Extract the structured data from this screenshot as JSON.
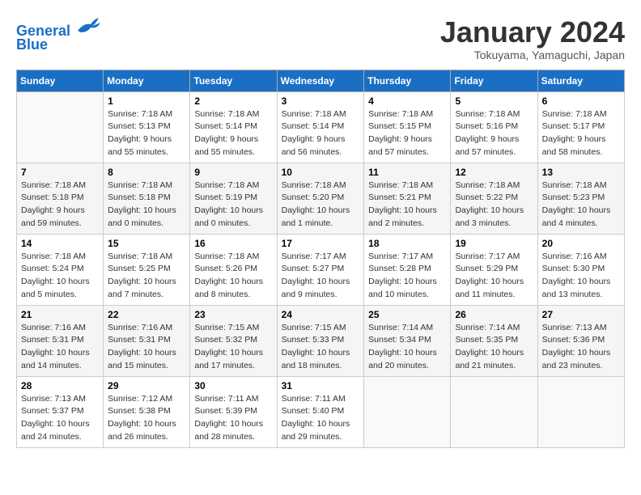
{
  "header": {
    "logo_line1": "General",
    "logo_line2": "Blue",
    "title": "January 2024",
    "location": "Tokuyama, Yamaguchi, Japan"
  },
  "days_of_week": [
    "Sunday",
    "Monday",
    "Tuesday",
    "Wednesday",
    "Thursday",
    "Friday",
    "Saturday"
  ],
  "weeks": [
    [
      {
        "day": "",
        "sunrise": "",
        "sunset": "",
        "daylight": ""
      },
      {
        "day": "1",
        "sunrise": "Sunrise: 7:18 AM",
        "sunset": "Sunset: 5:13 PM",
        "daylight": "Daylight: 9 hours and 55 minutes."
      },
      {
        "day": "2",
        "sunrise": "Sunrise: 7:18 AM",
        "sunset": "Sunset: 5:14 PM",
        "daylight": "Daylight: 9 hours and 55 minutes."
      },
      {
        "day": "3",
        "sunrise": "Sunrise: 7:18 AM",
        "sunset": "Sunset: 5:14 PM",
        "daylight": "Daylight: 9 hours and 56 minutes."
      },
      {
        "day": "4",
        "sunrise": "Sunrise: 7:18 AM",
        "sunset": "Sunset: 5:15 PM",
        "daylight": "Daylight: 9 hours and 57 minutes."
      },
      {
        "day": "5",
        "sunrise": "Sunrise: 7:18 AM",
        "sunset": "Sunset: 5:16 PM",
        "daylight": "Daylight: 9 hours and 57 minutes."
      },
      {
        "day": "6",
        "sunrise": "Sunrise: 7:18 AM",
        "sunset": "Sunset: 5:17 PM",
        "daylight": "Daylight: 9 hours and 58 minutes."
      }
    ],
    [
      {
        "day": "7",
        "sunrise": "Sunrise: 7:18 AM",
        "sunset": "Sunset: 5:18 PM",
        "daylight": "Daylight: 9 hours and 59 minutes."
      },
      {
        "day": "8",
        "sunrise": "Sunrise: 7:18 AM",
        "sunset": "Sunset: 5:18 PM",
        "daylight": "Daylight: 10 hours and 0 minutes."
      },
      {
        "day": "9",
        "sunrise": "Sunrise: 7:18 AM",
        "sunset": "Sunset: 5:19 PM",
        "daylight": "Daylight: 10 hours and 0 minutes."
      },
      {
        "day": "10",
        "sunrise": "Sunrise: 7:18 AM",
        "sunset": "Sunset: 5:20 PM",
        "daylight": "Daylight: 10 hours and 1 minute."
      },
      {
        "day": "11",
        "sunrise": "Sunrise: 7:18 AM",
        "sunset": "Sunset: 5:21 PM",
        "daylight": "Daylight: 10 hours and 2 minutes."
      },
      {
        "day": "12",
        "sunrise": "Sunrise: 7:18 AM",
        "sunset": "Sunset: 5:22 PM",
        "daylight": "Daylight: 10 hours and 3 minutes."
      },
      {
        "day": "13",
        "sunrise": "Sunrise: 7:18 AM",
        "sunset": "Sunset: 5:23 PM",
        "daylight": "Daylight: 10 hours and 4 minutes."
      }
    ],
    [
      {
        "day": "14",
        "sunrise": "Sunrise: 7:18 AM",
        "sunset": "Sunset: 5:24 PM",
        "daylight": "Daylight: 10 hours and 5 minutes."
      },
      {
        "day": "15",
        "sunrise": "Sunrise: 7:18 AM",
        "sunset": "Sunset: 5:25 PM",
        "daylight": "Daylight: 10 hours and 7 minutes."
      },
      {
        "day": "16",
        "sunrise": "Sunrise: 7:18 AM",
        "sunset": "Sunset: 5:26 PM",
        "daylight": "Daylight: 10 hours and 8 minutes."
      },
      {
        "day": "17",
        "sunrise": "Sunrise: 7:17 AM",
        "sunset": "Sunset: 5:27 PM",
        "daylight": "Daylight: 10 hours and 9 minutes."
      },
      {
        "day": "18",
        "sunrise": "Sunrise: 7:17 AM",
        "sunset": "Sunset: 5:28 PM",
        "daylight": "Daylight: 10 hours and 10 minutes."
      },
      {
        "day": "19",
        "sunrise": "Sunrise: 7:17 AM",
        "sunset": "Sunset: 5:29 PM",
        "daylight": "Daylight: 10 hours and 11 minutes."
      },
      {
        "day": "20",
        "sunrise": "Sunrise: 7:16 AM",
        "sunset": "Sunset: 5:30 PM",
        "daylight": "Daylight: 10 hours and 13 minutes."
      }
    ],
    [
      {
        "day": "21",
        "sunrise": "Sunrise: 7:16 AM",
        "sunset": "Sunset: 5:31 PM",
        "daylight": "Daylight: 10 hours and 14 minutes."
      },
      {
        "day": "22",
        "sunrise": "Sunrise: 7:16 AM",
        "sunset": "Sunset: 5:31 PM",
        "daylight": "Daylight: 10 hours and 15 minutes."
      },
      {
        "day": "23",
        "sunrise": "Sunrise: 7:15 AM",
        "sunset": "Sunset: 5:32 PM",
        "daylight": "Daylight: 10 hours and 17 minutes."
      },
      {
        "day": "24",
        "sunrise": "Sunrise: 7:15 AM",
        "sunset": "Sunset: 5:33 PM",
        "daylight": "Daylight: 10 hours and 18 minutes."
      },
      {
        "day": "25",
        "sunrise": "Sunrise: 7:14 AM",
        "sunset": "Sunset: 5:34 PM",
        "daylight": "Daylight: 10 hours and 20 minutes."
      },
      {
        "day": "26",
        "sunrise": "Sunrise: 7:14 AM",
        "sunset": "Sunset: 5:35 PM",
        "daylight": "Daylight: 10 hours and 21 minutes."
      },
      {
        "day": "27",
        "sunrise": "Sunrise: 7:13 AM",
        "sunset": "Sunset: 5:36 PM",
        "daylight": "Daylight: 10 hours and 23 minutes."
      }
    ],
    [
      {
        "day": "28",
        "sunrise": "Sunrise: 7:13 AM",
        "sunset": "Sunset: 5:37 PM",
        "daylight": "Daylight: 10 hours and 24 minutes."
      },
      {
        "day": "29",
        "sunrise": "Sunrise: 7:12 AM",
        "sunset": "Sunset: 5:38 PM",
        "daylight": "Daylight: 10 hours and 26 minutes."
      },
      {
        "day": "30",
        "sunrise": "Sunrise: 7:11 AM",
        "sunset": "Sunset: 5:39 PM",
        "daylight": "Daylight: 10 hours and 28 minutes."
      },
      {
        "day": "31",
        "sunrise": "Sunrise: 7:11 AM",
        "sunset": "Sunset: 5:40 PM",
        "daylight": "Daylight: 10 hours and 29 minutes."
      },
      {
        "day": "",
        "sunrise": "",
        "sunset": "",
        "daylight": ""
      },
      {
        "day": "",
        "sunrise": "",
        "sunset": "",
        "daylight": ""
      },
      {
        "day": "",
        "sunrise": "",
        "sunset": "",
        "daylight": ""
      }
    ]
  ]
}
